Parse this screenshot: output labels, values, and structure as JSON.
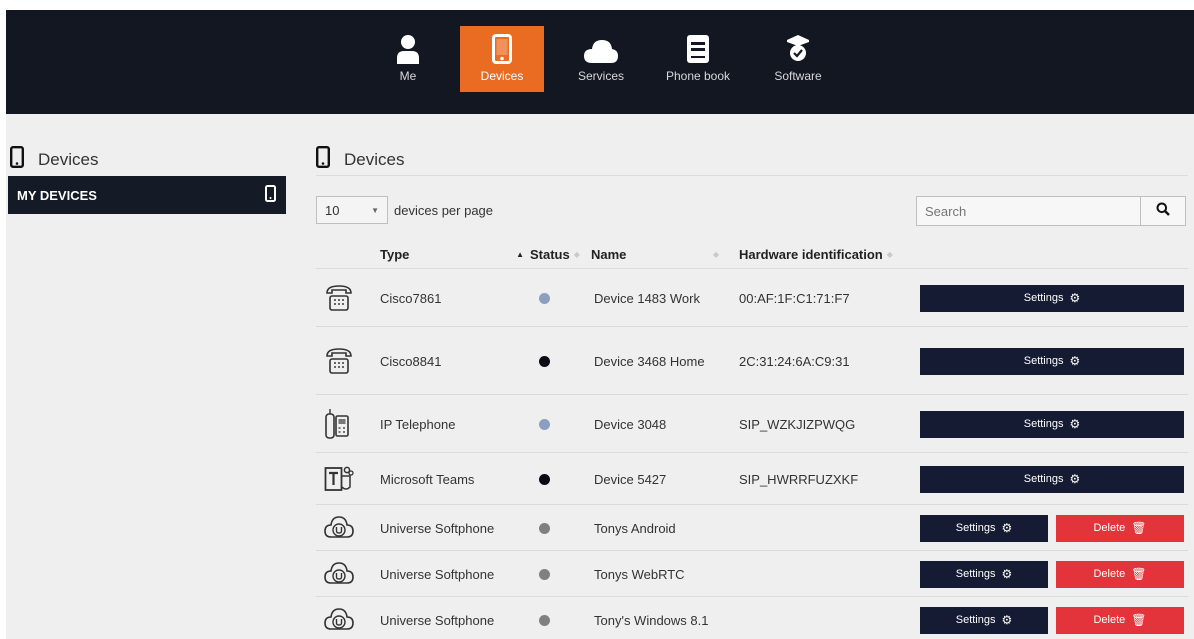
{
  "nav": {
    "items": [
      {
        "label": "Me",
        "icon": "person-icon"
      },
      {
        "label": "Devices",
        "icon": "phone-icon",
        "active": true
      },
      {
        "label": "Services",
        "icon": "cloud-icon"
      },
      {
        "label": "Phone book",
        "icon": "book-icon"
      },
      {
        "label": "Software",
        "icon": "software-icon"
      }
    ]
  },
  "sidebar": {
    "title": "Devices",
    "items": [
      {
        "label": "MY DEVICES"
      }
    ]
  },
  "main": {
    "title": "Devices",
    "per_page_value": "10",
    "per_page_label": "devices per page",
    "search_placeholder": "Search"
  },
  "table": {
    "columns": [
      "Type",
      "Status",
      "Name",
      "Hardware identification"
    ],
    "settings_label": "Settings",
    "delete_label": "Delete",
    "rows": [
      {
        "type": "Cisco7861",
        "status_color": "#8d9fc0",
        "name": "Device 1483 Work",
        "hwid": "00:AF:1F:C1:71:F7",
        "icon": "desk-phone-icon",
        "deletable": false
      },
      {
        "type": "Cisco8841",
        "status_color": "#0b0b14",
        "name": "Device 3468 Home",
        "hwid": "2C:31:24:6A:C9:31",
        "icon": "desk-phone-icon",
        "deletable": false
      },
      {
        "type": "IP Telephone",
        "status_color": "#8d9fc0",
        "name": "Device 3048",
        "hwid": "SIP_WZKJIZPWQG",
        "icon": "ip-phone-icon",
        "deletable": false
      },
      {
        "type": "Microsoft Teams",
        "status_color": "#0b0b14",
        "name": "Device 5427",
        "hwid": "SIP_HWRRFUZXKF",
        "icon": "teams-icon",
        "deletable": false
      },
      {
        "type": "Universe Softphone",
        "status_color": "#808080",
        "name": "Tonys Android",
        "hwid": "",
        "icon": "softphone-cloud-icon",
        "deletable": true
      },
      {
        "type": "Universe Softphone",
        "status_color": "#808080",
        "name": "Tonys WebRTC",
        "hwid": "",
        "icon": "softphone-cloud-icon",
        "deletable": true
      },
      {
        "type": "Universe Softphone",
        "status_color": "#808080",
        "name": "Tony's Windows 8.1",
        "hwid": "",
        "icon": "softphone-cloud-icon",
        "deletable": true
      }
    ]
  },
  "colors": {
    "nav_bg": "#121722",
    "active_accent": "#ea6c22",
    "button_dark": "#141b33",
    "button_delete": "#e2343a",
    "page_bg": "#efefef"
  }
}
